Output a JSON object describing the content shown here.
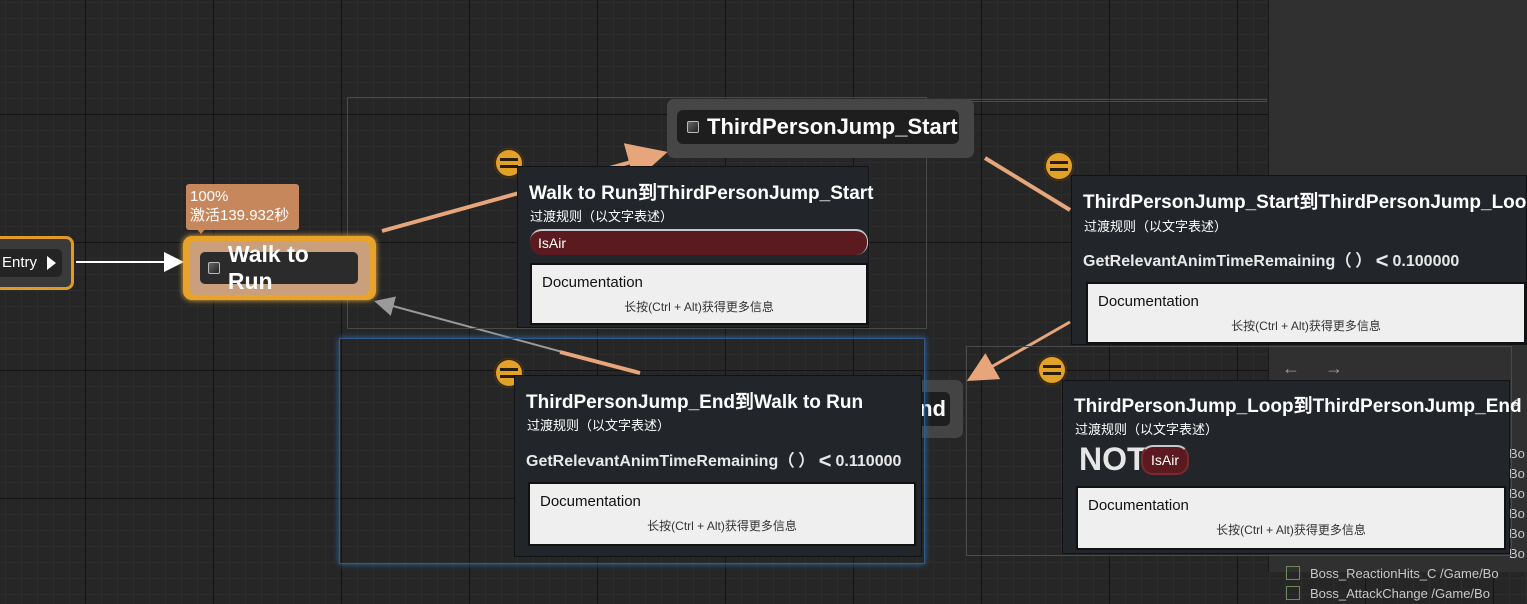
{
  "entry": {
    "label": "Entry"
  },
  "walk_node": {
    "label": "Walk to Run",
    "debug": {
      "weight": "100%",
      "active_time": "激活139.932秒"
    }
  },
  "jump_start_node": {
    "label": "ThirdPersonJump_Start"
  },
  "jump_end_node": {
    "visible_label": "nd"
  },
  "transitions": [
    {
      "title": "Walk to Run到ThirdPersonJump_Start",
      "subtitle": "过渡规则（以文字表述）",
      "condition_var": "IsAir",
      "doc_title": "Documentation",
      "doc_hint": "长按(Ctrl + Alt)获得更多信息"
    },
    {
      "title": "ThirdPersonJump_Start到ThirdPersonJump_Loop",
      "subtitle": "过渡规则（以文字表述）",
      "func": "GetRelevantAnimTimeRemaining（ ）",
      "op": "<",
      "value": "0.100000",
      "doc_title": "Documentation",
      "doc_hint": "长按(Ctrl + Alt)获得更多信息"
    },
    {
      "title": "ThirdPersonJump_End到Walk to Run",
      "subtitle": "过渡规则（以文字表述）",
      "func": "GetRelevantAnimTimeRemaining（ ）",
      "op": "<",
      "value": "0.110000",
      "doc_title": "Documentation",
      "doc_hint": "长按(Ctrl + Alt)获得更多信息"
    },
    {
      "title": "ThirdPersonJump_Loop到ThirdPersonJump_End",
      "subtitle": "过渡规则（以文字表述）",
      "not": "NOT",
      "condition_var": "IsAir",
      "doc_title": "Documentation",
      "doc_hint": "长按(Ctrl + Alt)获得更多信息"
    }
  ],
  "asset_browser": {
    "nav": "← →",
    "search_icon": "search-icon",
    "rows": [
      "Bo",
      "Bo",
      "Bo",
      "Bo",
      "Bo",
      "Bo",
      "Boss_ReactionHits_C  /Game/Bo",
      "Boss_AttackChange /Game/Bo"
    ]
  },
  "colors": {
    "state_active": "#e9a32a",
    "transition_icon": "#e2a128",
    "wire_active": "#e7a57c",
    "bool_pin": "#5b1a1f"
  }
}
